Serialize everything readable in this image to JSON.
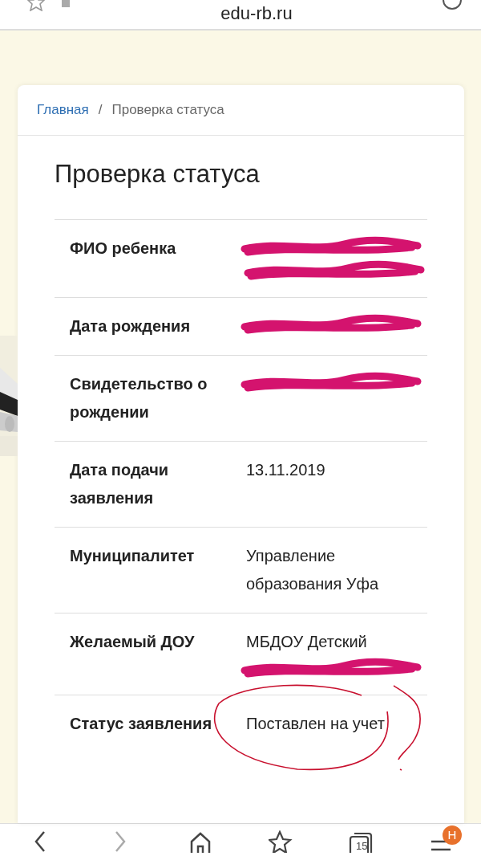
{
  "browser_top": {
    "url": "edu-rb.ru"
  },
  "breadcrumb": [
    {
      "label": "Главная",
      "link": true
    },
    {
      "label": "Проверка статуса",
      "link": false
    }
  ],
  "breadcrumb_separator": "/",
  "title": "Проверка статуса",
  "rows": [
    {
      "label": "ФИО ребенка",
      "redactions": [
        {
          "kind": "scribble"
        },
        {
          "kind": "scribble"
        }
      ]
    },
    {
      "label": "Дата рождения",
      "redactions": [
        {
          "kind": "scribble"
        }
      ]
    },
    {
      "label": "Свидетельство о рождении",
      "redactions": [
        {
          "kind": "scribble"
        }
      ]
    },
    {
      "label": "Дата подачи заявления",
      "value": "13.11.2019"
    },
    {
      "label": "Муниципалитет",
      "value": "Управление образования Уфа"
    },
    {
      "label": "Желаемый ДОУ",
      "value": "МБДОУ Детский",
      "redactions": [
        {
          "kind": "scribble"
        }
      ]
    },
    {
      "label": "Статус заявления",
      "value": "Поставлен на учет",
      "circled": true
    }
  ],
  "bottom_nav": [
    {
      "kind": "back",
      "disabled": false
    },
    {
      "kind": "forward",
      "disabled": true
    },
    {
      "kind": "home",
      "disabled": false
    },
    {
      "kind": "bookmarks",
      "disabled": false
    },
    {
      "kind": "tabs",
      "count": "15",
      "disabled": false
    },
    {
      "kind": "menu",
      "badge": "Н",
      "disabled": false
    }
  ]
}
